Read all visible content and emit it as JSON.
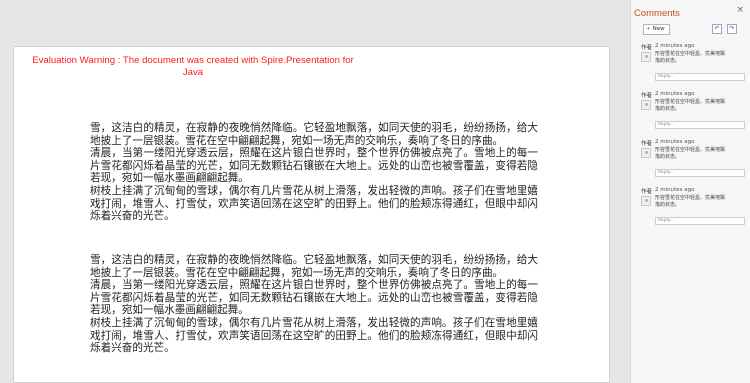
{
  "warning": {
    "line1": "Evaluation Warning : The document was created with  Spire.Presentation for",
    "line2": "Java"
  },
  "paragraph_a": "雪，这洁白的精灵，在寂静的夜晚悄然降临。它轻盈地飘落，如同天使的羽毛，纷纷扬扬，给大地披上了一层银装。雪花在空中翩翩起舞，宛如一场无声的交响乐，奏响了冬日的序曲。",
  "paragraph_b": "清晨，当第一缕阳光穿透云层，照耀在这片银白世界时，整个世界仿佛被点亮了。雪地上的每一片雪花都闪烁着晶莹的光芒，如同无数颗钻石镶嵌在大地上。远处的山峦也被雪覆盖，变得若隐若现，宛如一幅水墨画翩翩起舞。",
  "paragraph_c": "树枝上挂满了沉甸甸的雪球，偶尔有几片雪花从树上滑落，发出轻微的声响。孩子们在雪地里嬉戏打闹，堆雪人、打雪仗，欢声笑语回荡在这空旷的田野上。他们的脸颊冻得通红，但眼中却闪烁着兴奋的光芒。",
  "comments_panel": {
    "title": "Comments",
    "close": "×",
    "new_label": "New",
    "new_icon": "+",
    "prev_icon": "↶",
    "next_icon": "↷",
    "comments": [
      {
        "author": "作者",
        "time": "2 minutes ago",
        "text": "形容雪花在空中轻盈、优美地飘落的状态。",
        "reply_placeholder": "Reply..."
      },
      {
        "author": "作者",
        "time": "2 minutes ago",
        "text": "形容雪花在空中轻盈、优美地飘落的状态。",
        "reply_placeholder": "Reply..."
      },
      {
        "author": "作者",
        "time": "2 minutes ago",
        "text": "形容雪花在空中轻盈、优美地飘落的状态。",
        "reply_placeholder": "Reply..."
      },
      {
        "author": "作者",
        "time": "2 minutes ago",
        "text": "形容雪花在空中轻盈、优美地飘落的状态。",
        "reply_placeholder": "Reply..."
      }
    ]
  }
}
